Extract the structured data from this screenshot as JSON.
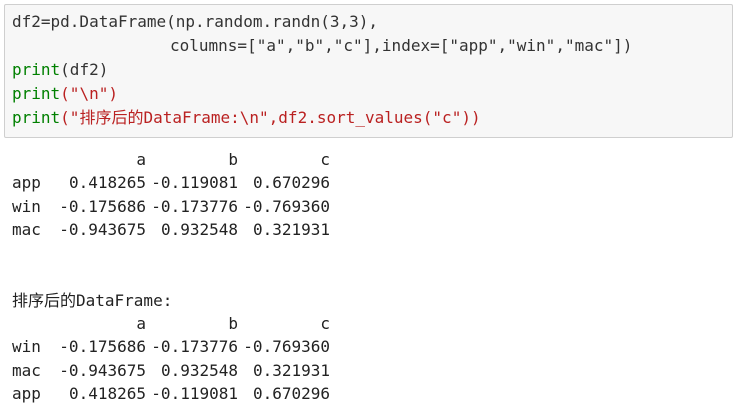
{
  "code": {
    "line1": "df2=pd.DataFrame(np.random.randn(3,3),",
    "line2": "columns=[\"a\",\"b\",\"c\"],index=[\"app\",\"win\",\"mac\"])",
    "line3_kw": "print",
    "line3_rest": "(df2)",
    "line4_kw": "print",
    "line4_rest": "(\"\\n\")",
    "line5_kw": "print",
    "line5_rest": "(\"排序后的DataFrame:\\n\",df2.sort_values(\"c\"))"
  },
  "output": {
    "table1": {
      "columns": [
        "a",
        "b",
        "c"
      ],
      "rows": [
        {
          "index": "app",
          "a": "0.418265",
          "b": "-0.119081",
          "c": "0.670296"
        },
        {
          "index": "win",
          "a": "-0.175686",
          "b": "-0.173776",
          "c": "-0.769360"
        },
        {
          "index": "mac",
          "a": "-0.943675",
          "b": "0.932548",
          "c": "0.321931"
        }
      ]
    },
    "caption": "排序后的DataFrame:",
    "table2": {
      "columns": [
        "a",
        "b",
        "c"
      ],
      "rows": [
        {
          "index": "win",
          "a": "-0.175686",
          "b": "-0.173776",
          "c": "-0.769360"
        },
        {
          "index": "mac",
          "a": "-0.943675",
          "b": "0.932548",
          "c": "0.321931"
        },
        {
          "index": "app",
          "a": "0.418265",
          "b": "-0.119081",
          "c": "0.670296"
        }
      ]
    }
  }
}
